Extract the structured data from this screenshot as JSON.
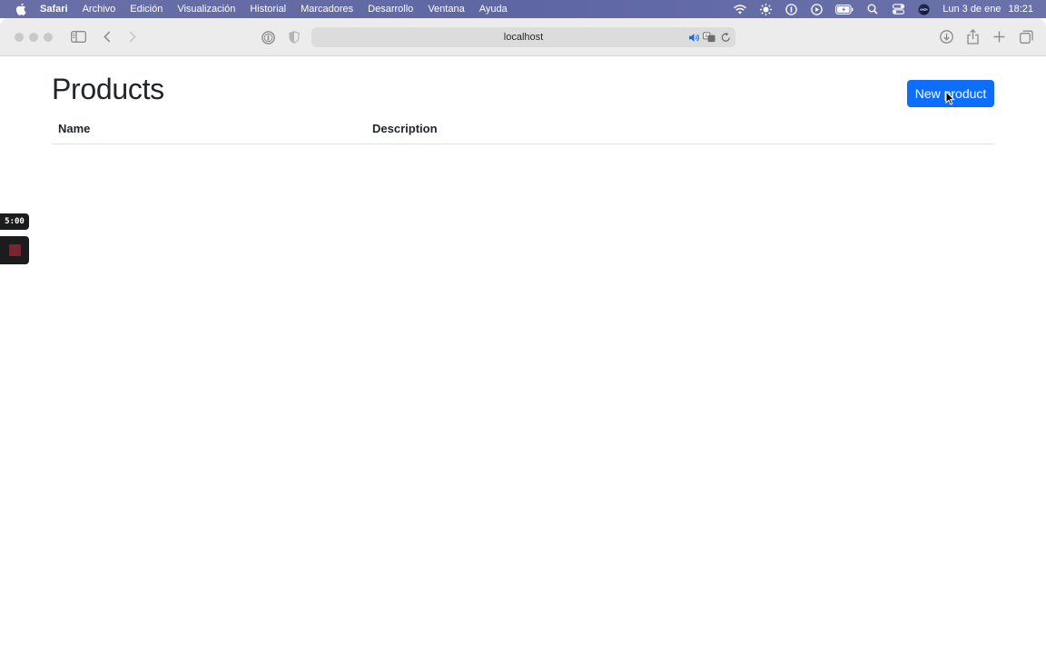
{
  "menubar": {
    "app_name": "Safari",
    "items": [
      "Archivo",
      "Edición",
      "Visualización",
      "Historial",
      "Marcadores",
      "Desarrollo",
      "Ventana",
      "Ayuda"
    ],
    "date": "Lun 3 de ene",
    "time": "18:21",
    "status_icons": [
      "wifi-icon",
      "brightness-icon",
      "password-manager-icon",
      "play-icon",
      "battery-icon",
      "search-icon",
      "control-center-icon",
      "siri-icon"
    ]
  },
  "browser": {
    "url": "localhost",
    "toolbar_icons": [
      "sidebar-icon",
      "back-icon",
      "forward-icon",
      "password-icon",
      "shield-icon",
      "audio-icon",
      "translate-icon",
      "reload-icon",
      "download-icon",
      "share-icon",
      "new-tab-icon",
      "tab-overview-icon"
    ]
  },
  "page": {
    "title": "Products",
    "new_button_label": "New product",
    "table": {
      "columns": [
        "Name",
        "Description"
      ],
      "rows": []
    }
  },
  "recorder": {
    "timer": "5:00"
  },
  "colors": {
    "primary_button": "#0d6efd",
    "menubar": "#646ba6",
    "record_stop": "#7a2630"
  }
}
